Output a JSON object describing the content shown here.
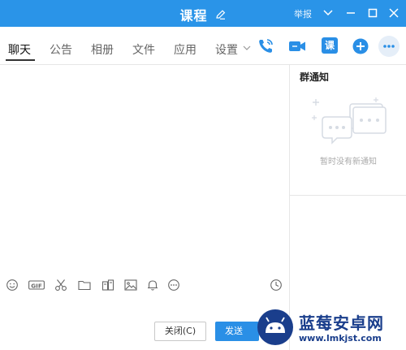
{
  "window": {
    "title": "课程",
    "report_label": "举报"
  },
  "tabs": [
    {
      "label": "聊天",
      "active": true
    },
    {
      "label": "公告",
      "active": false
    },
    {
      "label": "相册",
      "active": false
    },
    {
      "label": "文件",
      "active": false
    },
    {
      "label": "应用",
      "active": false
    },
    {
      "label": "设置",
      "active": false
    }
  ],
  "toolbar_icons": [
    "phone-call-icon",
    "video-call-icon",
    "course-icon",
    "add-circle-icon",
    "more-icon"
  ],
  "course_button_label": "课",
  "notice_panel": {
    "title": "群通知",
    "empty_text": "暂时没有新通知"
  },
  "input_toolbar_icons": [
    "emoji-icon",
    "gif-icon",
    "scissors-icon",
    "folder-icon",
    "image-editor-icon",
    "picture-icon",
    "bell-icon",
    "more-circle-icon",
    "history-clock-icon"
  ],
  "gif_label": "GIF",
  "buttons": {
    "close_label": "关闭(C)",
    "send_label": "发送"
  },
  "watermark": {
    "name": "蓝莓安卓网",
    "url": "www.lmkjst.com"
  },
  "colors": {
    "accent": "#2a94e8",
    "button_blue": "#2a8fe6"
  }
}
